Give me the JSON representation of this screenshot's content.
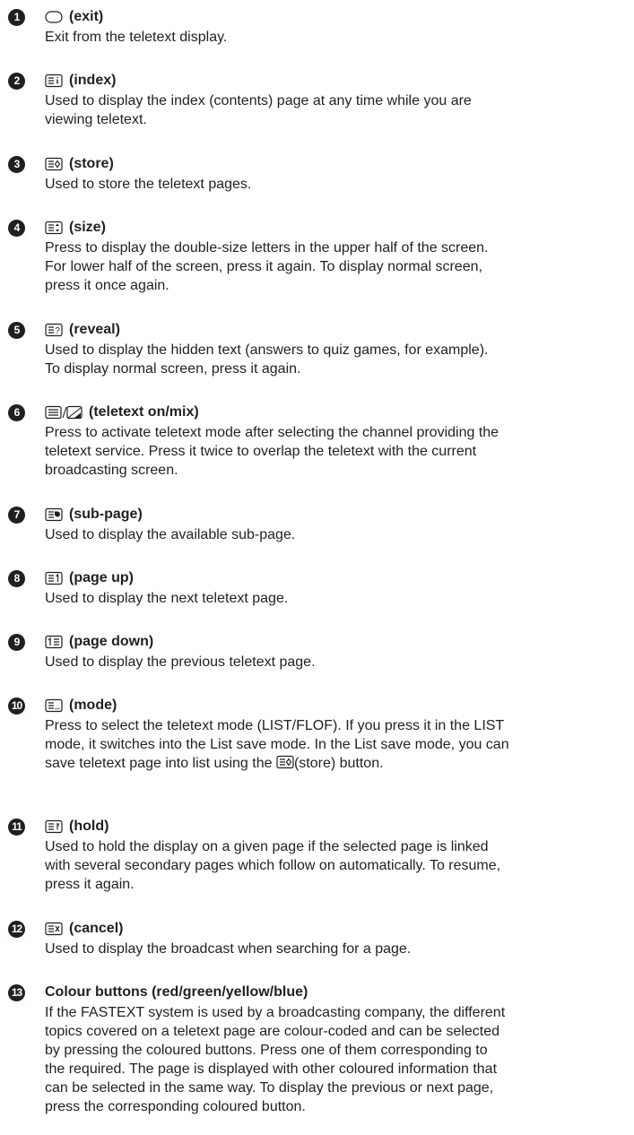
{
  "items": [
    {
      "number": "1",
      "icon": "exit-icon",
      "title": "(exit)",
      "description": "Exit from the teletext display."
    },
    {
      "number": "2",
      "icon": "index-icon",
      "title": "(index)",
      "description": "Used to display the index (contents) page at any time while you are\nviewing teletext."
    },
    {
      "number": "3",
      "icon": "store-icon",
      "title": "(store)",
      "description": "Used to store the teletext pages."
    },
    {
      "number": "4",
      "icon": "size-icon",
      "title": "(size)",
      "description": "Press to display the double-size letters in the upper half of the screen.\nFor lower half of the screen, press it again. To display normal screen,\npress it once again."
    },
    {
      "number": "5",
      "icon": "reveal-icon",
      "title": "(reveal)",
      "description": "Used to display the hidden text (answers to quiz games, for example).\nTo display normal screen, press it again."
    },
    {
      "number": "6",
      "icon": "teletext-mix-icon",
      "title": "(teletext on/mix)",
      "description": "Press to activate teletext mode after selecting the channel providing the\nteletext service. Press it twice to overlap the teletext with the current\nbroadcasting screen."
    },
    {
      "number": "7",
      "icon": "sub-page-icon",
      "title": "(sub-page)",
      "description": "Used to display the available sub-page."
    },
    {
      "number": "8",
      "icon": "page-up-icon",
      "title": "(page up)",
      "description": "Used to display the next teletext page."
    },
    {
      "number": "9",
      "icon": "page-down-icon",
      "title": "(page down)",
      "description": "Used to display the previous teletext page."
    },
    {
      "number": "10",
      "icon": "mode-icon",
      "title": "(mode)",
      "description": "Press to select the teletext mode (LIST/FLOF). If you press it in the LIST\nmode, it switches into the List save mode. In the List save mode, you can\nsave teletext page into list using the ",
      "description_icon": "store-icon",
      "description_tail": "(store) button."
    },
    {
      "number": "11",
      "icon": "hold-icon",
      "title": "(hold)",
      "description": "Used to hold the display on a given page if the selected page is linked\nwith several secondary pages which follow on automatically. To resume,\npress it again."
    },
    {
      "number": "12",
      "icon": "cancel-icon",
      "title": "(cancel)",
      "description": "Used to display the broadcast when searching for a page."
    },
    {
      "number": "13",
      "icon": "",
      "title": "Colour buttons (red/green/yellow/blue)",
      "description": "If the FASTEXT system is used by a broadcasting company, the different\ntopics covered on a teletext page are colour-coded and can be selected\nby pressing the coloured buttons. Press one of them corresponding to\nthe required. The page is displayed with other coloured information that\ncan be selected in the same way. To display the previous or next page,\npress the corresponding coloured button."
    }
  ]
}
